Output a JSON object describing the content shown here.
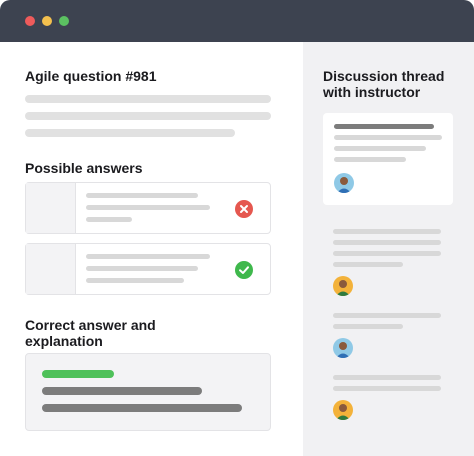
{
  "window": {
    "controls": [
      "close",
      "minimize",
      "maximize"
    ],
    "colors": {
      "close": "#ef5b5b",
      "minimize": "#f4c04e",
      "maximize": "#5bc161",
      "titlebar": "#3d4350"
    }
  },
  "question": {
    "title": "Agile question #981"
  },
  "answers": {
    "heading": "Possible answers",
    "items": [
      {
        "status": "incorrect",
        "icon": "x-icon",
        "color": "#e5574f"
      },
      {
        "status": "correct",
        "icon": "check-icon",
        "color": "#3fb84c"
      }
    ]
  },
  "explanation": {
    "heading": "Correct answer and explanation"
  },
  "discussion": {
    "heading": "Discussion thread with instructor",
    "avatars": [
      "avatar-blue",
      "avatar-yellow",
      "avatar-blue",
      "avatar-yellow"
    ]
  }
}
